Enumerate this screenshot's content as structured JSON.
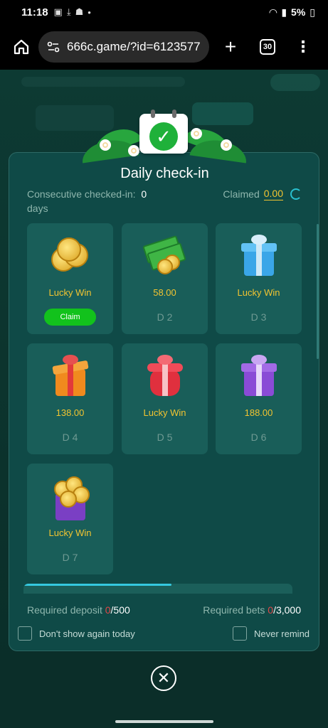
{
  "status_bar": {
    "time": "11:18",
    "battery": "5%"
  },
  "browser": {
    "url": "666c.game/?id=6123577",
    "tabs_count": "30"
  },
  "dialog": {
    "title": "Daily check-in",
    "consecutive_label": "Consecutive checked-in:",
    "consecutive_value": "0",
    "consecutive_unit": "days",
    "claimed_label": "Claimed",
    "claimed_value": "0.00",
    "cards": [
      {
        "reward": "Lucky Win",
        "claim_label": "Claim",
        "icon": "coin-stack-icon"
      },
      {
        "reward": "58.00",
        "day": "D 2",
        "icon": "cash-and-coins-icon"
      },
      {
        "reward": "Lucky Win",
        "day": "D 3",
        "icon": "blue-gift-icon"
      },
      {
        "reward": "138.00",
        "day": "D 4",
        "icon": "open-gift-box-icon"
      },
      {
        "reward": "Lucky Win",
        "day": "D 5",
        "icon": "red-gift-icon"
      },
      {
        "reward": "188.00",
        "day": "D 6",
        "icon": "purple-gift-icon"
      },
      {
        "reward": "Lucky Win",
        "day": "D 7",
        "icon": "gold-treasure-icon"
      }
    ],
    "required_deposit_label": "Required deposit",
    "required_deposit_current": "0",
    "required_deposit_total": "/500",
    "required_bets_label": "Required bets",
    "required_bets_current": "0",
    "required_bets_total": "/3,000",
    "dont_show_label": "Don't show again today",
    "never_remind_label": "Never remind"
  },
  "colors": {
    "accent_gold": "#f2c431",
    "claim_green": "#12c21c",
    "modal_bg": "#0f4a47",
    "card_bg": "#195e59",
    "progress_cyan": "#35c8e0",
    "alert_red": "#e04848"
  },
  "icons": {
    "home": "home-icon",
    "site_settings": "site-settings-icon",
    "add_tab": "plus-icon",
    "tabs": "tab-switcher-icon",
    "menu": "more-vert-icon",
    "refresh": "refresh-icon",
    "close": "close-circle-icon"
  }
}
